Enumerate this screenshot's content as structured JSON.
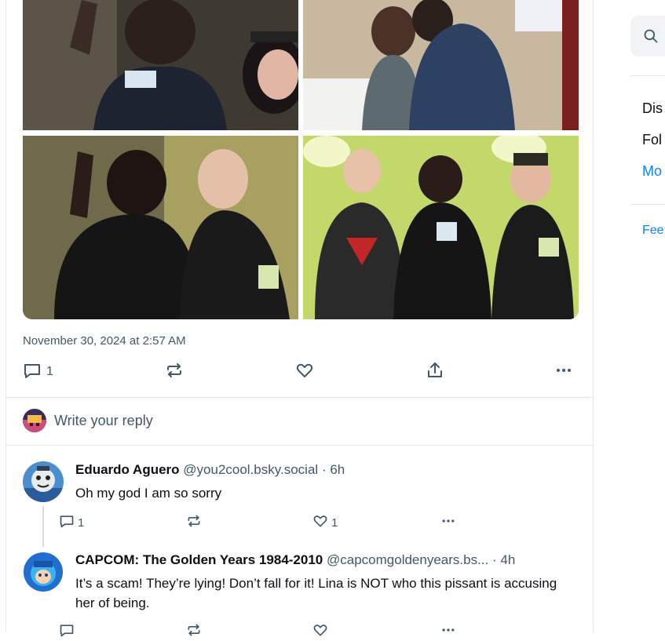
{
  "post": {
    "timestamp": "November 30, 2024 at 2:57 AM",
    "reply_count": "1",
    "repost_count": "",
    "like_count": ""
  },
  "composer": {
    "placeholder": "Write your reply"
  },
  "replies": [
    {
      "name": "Eduardo Aguero",
      "handle": "@you2cool.bsky.social",
      "time": "· 6h",
      "text": "Oh my god I am so sorry",
      "reply_count": "1",
      "like_count": "1"
    },
    {
      "name": "CAPCOM: The Golden Years 1984-2010",
      "handle": "@capcomgoldenyears.bs...",
      "time": "· 4h",
      "text": "It’s a scam! They’re lying! Don’t fall for it! Lina is NOT who this pissant is accusing her of being."
    }
  ],
  "sidebar": {
    "search_icon": "search-icon",
    "item1": "Dis",
    "item2": "Fol",
    "item3": "Mo",
    "item4": "Fee"
  },
  "colors": {
    "accent": "#1083fe",
    "muted": "#42576c",
    "border": "#e3e8ee"
  }
}
